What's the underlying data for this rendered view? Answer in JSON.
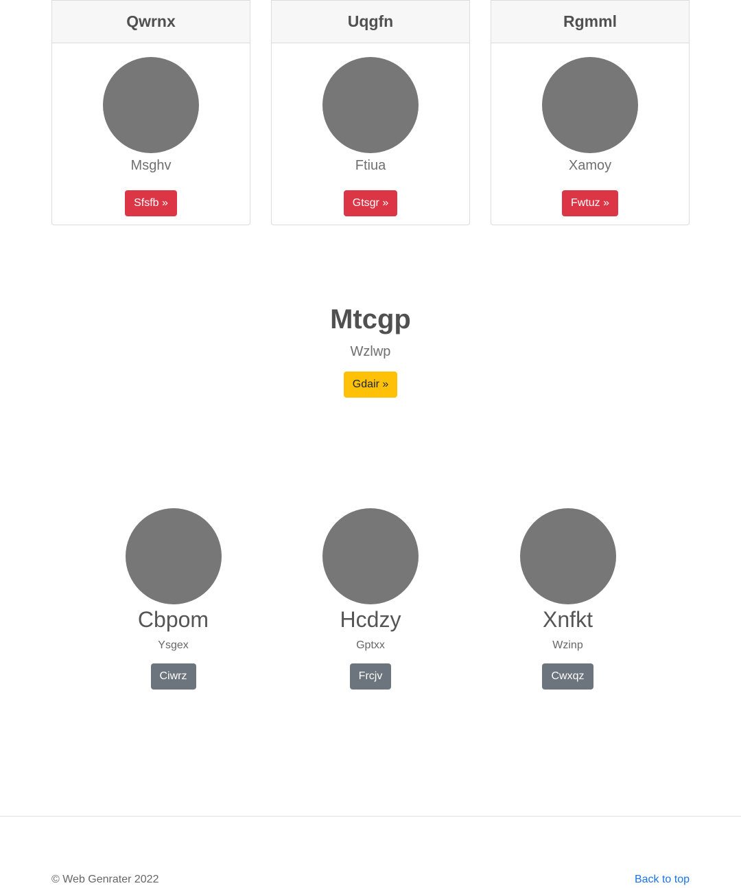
{
  "cards": [
    {
      "title": "Qwrnx",
      "subtitle": "Msghv",
      "button": "Sfsfb »"
    },
    {
      "title": "Uqgfn",
      "subtitle": "Ftiua",
      "button": "Gtsgr »"
    },
    {
      "title": "Rgmml",
      "subtitle": "Xamoy",
      "button": "Fwtuz »"
    }
  ],
  "hero": {
    "title": "Mtcgp",
    "subtitle": "Wzlwp",
    "button": "Gdair »"
  },
  "people": [
    {
      "name": "Cbpom",
      "subtitle": "Ysgex",
      "button": "Ciwrz"
    },
    {
      "name": "Hcdzy",
      "subtitle": "Gptxx",
      "button": "Frcjv"
    },
    {
      "name": "Xnfkt",
      "subtitle": "Wzinp",
      "button": "Cwxqz"
    }
  ],
  "footer": {
    "copyright": "© Web Genrater 2022",
    "back_to_top": "Back to top"
  },
  "colors": {
    "danger": "#dc3545",
    "warning": "#ffc107",
    "secondary": "#6c757d",
    "avatar": "#777777",
    "link": "#1a73e8"
  }
}
